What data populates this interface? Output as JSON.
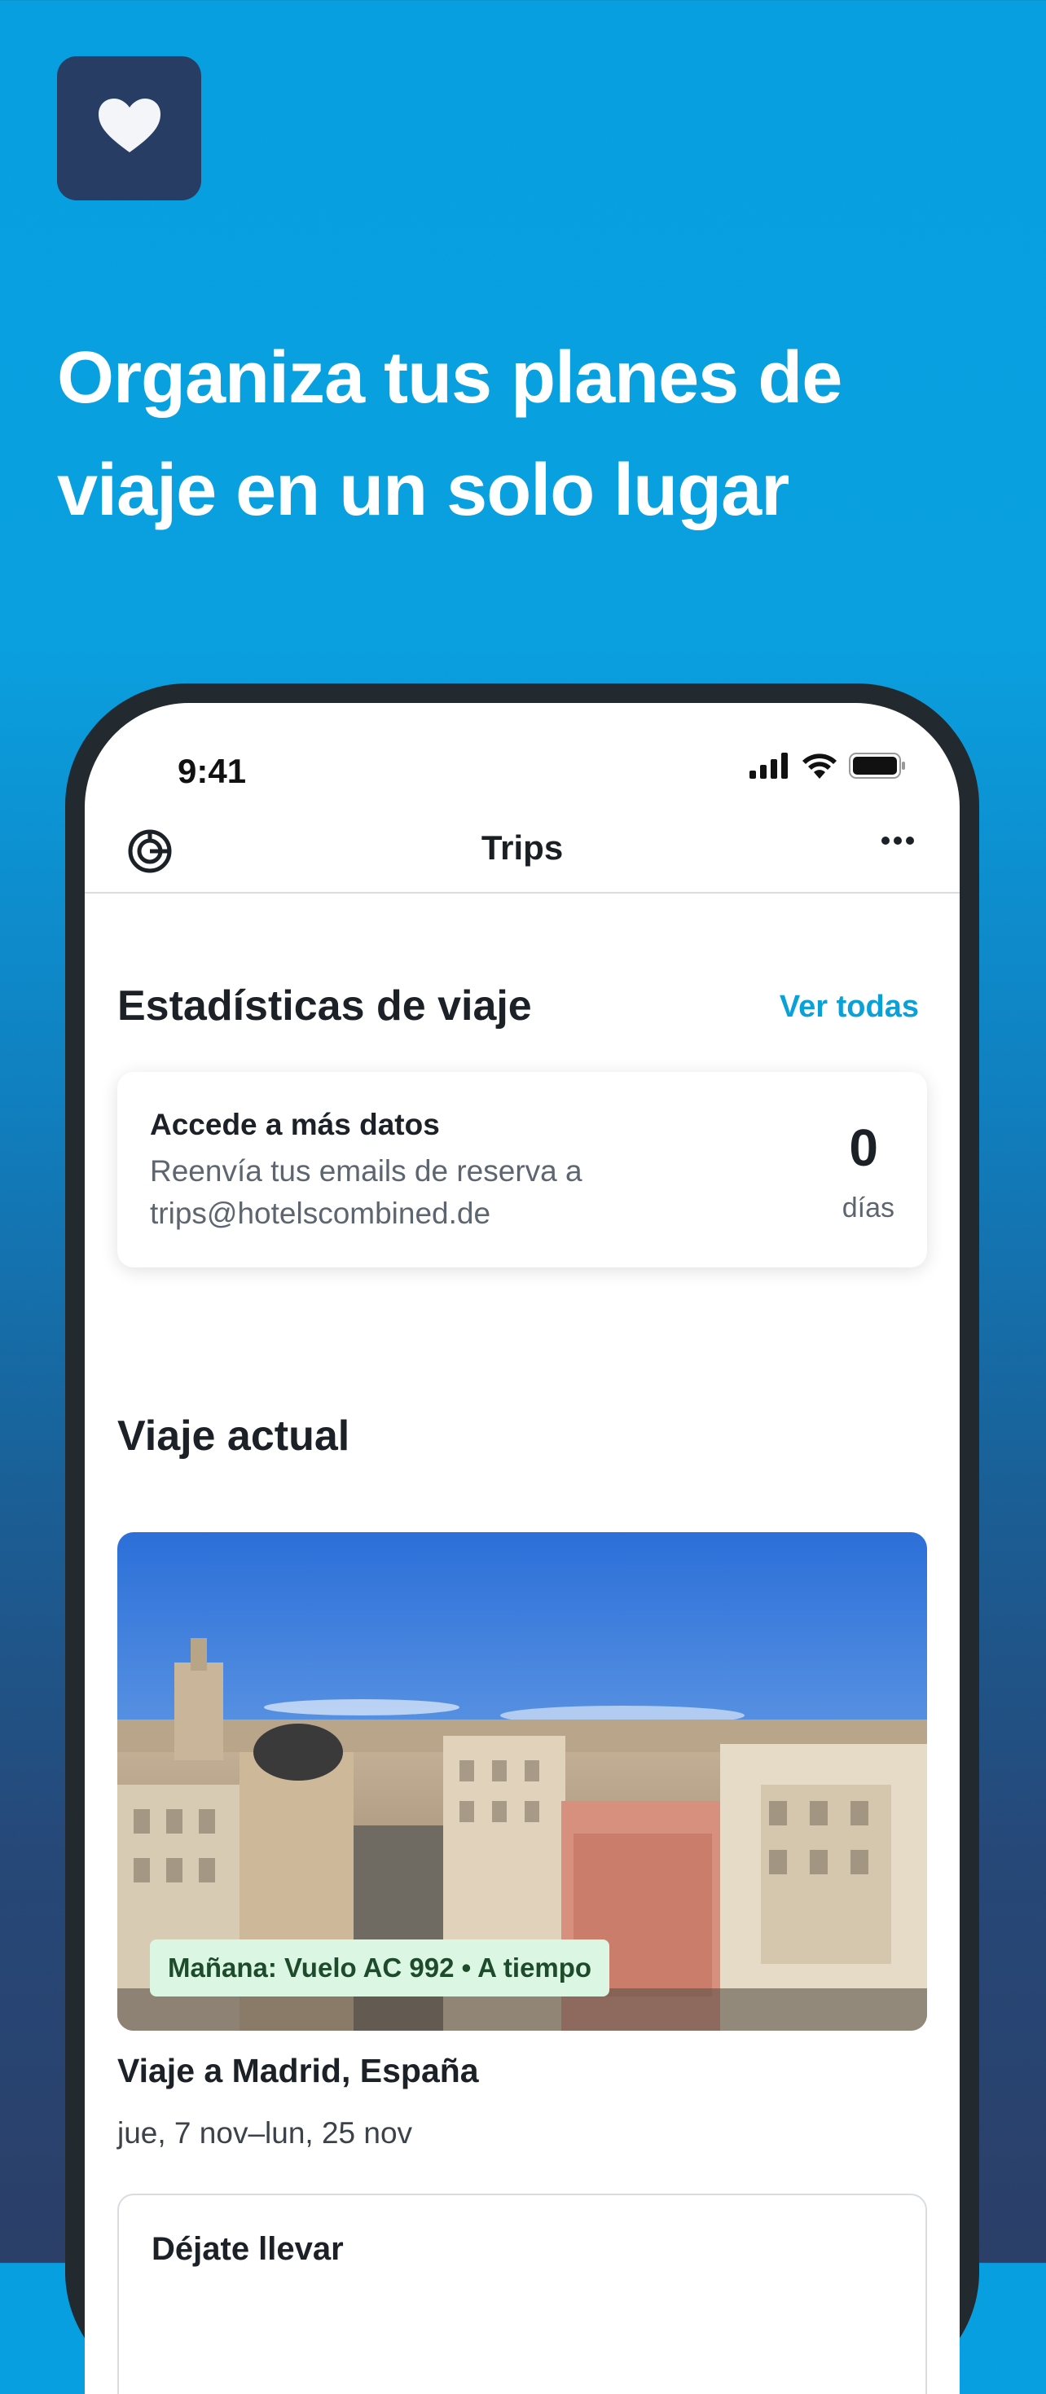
{
  "promo": {
    "badge_icon": "heart-icon",
    "headline": "Organiza tus planes de viaje en un solo lugar"
  },
  "status_bar": {
    "time": "9:41",
    "icons": [
      "signal-icon",
      "wifi-icon",
      "battery-icon"
    ]
  },
  "navbar": {
    "left_icon": "trips-logo-icon",
    "title": "Trips",
    "right_icon": "more-options-icon"
  },
  "stats": {
    "title": "Estadísticas de viaje",
    "link": "Ver todas",
    "card_title": "Accede a más datos",
    "card_body": "Reenvía tus emails de reserva a trips@hotelscombined.de",
    "count": "0",
    "unit": "días"
  },
  "current_trip": {
    "section_title": "Viaje actual",
    "flight_status": "Mañana: Vuelo AC 992 • A tiempo",
    "name": "Viaje a Madrid, España",
    "dates": "jue, 7 nov–lun, 25 nov"
  },
  "inspire": {
    "title": "Déjate llevar"
  },
  "colors": {
    "background_top": "#079fe0",
    "background_bottom": "#2b3f68",
    "badge": "#273d63",
    "accent_link": "#0aa0d8",
    "status_pill": "#dbf7e3"
  }
}
